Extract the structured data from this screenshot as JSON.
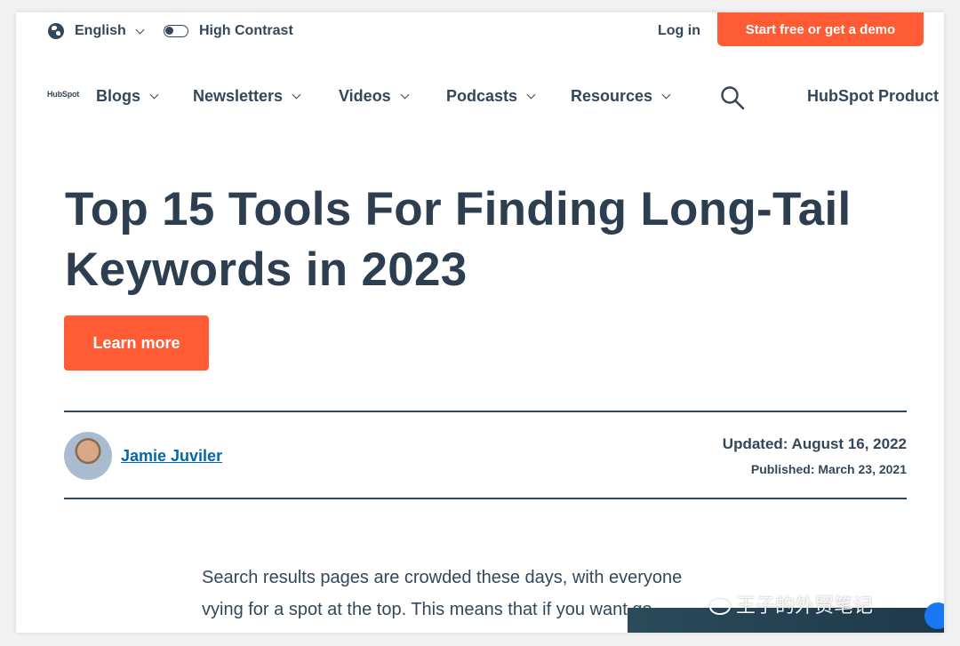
{
  "utility": {
    "language": "English",
    "contrast_label": "High Contrast",
    "login": "Log in",
    "cta": "Start free or get a demo"
  },
  "nav": {
    "logo": "HubSpot",
    "items": [
      {
        "label": "Blogs"
      },
      {
        "label": "Newsletters"
      },
      {
        "label": "Videos"
      },
      {
        "label": "Podcasts"
      },
      {
        "label": "Resources"
      }
    ],
    "products": "HubSpot Product"
  },
  "article": {
    "title_line1": "Top 15 Tools For Finding Long-Tail",
    "title_line2": "Keywords in 2023",
    "learn_more": "Learn more",
    "author": "Jamie Juviler",
    "updated": "Updated: August 16, 2022",
    "published": "Published: March 23, 2021",
    "body_line1": "Search results pages are crowded these days, with everyone",
    "body_line2": "vying for a spot at the top. This means that if you want go"
  },
  "watermark": "王子的外贸笔记",
  "colors": {
    "accent": "#ff5c35",
    "text": "#33475b",
    "link": "#0068b1"
  }
}
